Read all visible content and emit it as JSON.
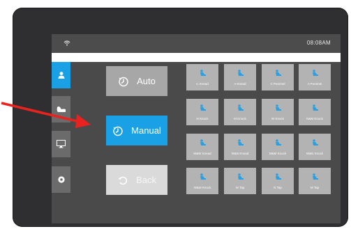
{
  "statusbar": {
    "time": "08:08AM",
    "wifi_icon": "wifi-icon"
  },
  "sidebar": {
    "items": [
      {
        "icon": "user-icon",
        "active": true
      },
      {
        "icon": "massage-chair-icon",
        "active": false
      },
      {
        "icon": "monitor-icon",
        "active": false
      },
      {
        "icon": "settings-icon",
        "active": false
      }
    ]
  },
  "modes": {
    "auto_label": "Auto",
    "manual_label": "Manual",
    "back_label": "Back"
  },
  "programs": [
    "C Knead",
    "A Knead",
    "C Pummel",
    "A Pummel",
    "N Knock",
    "M Knock",
    "W Knock",
    "N&M Knock",
    "M&W Knead",
    "W&N Knead",
    "M&M Knock",
    "W&N Knock",
    "W&M Knock",
    "W Tap",
    "N Tap",
    "M Tap"
  ],
  "colors": {
    "accent": "#1aa0e5",
    "tile": "#b3b3b3",
    "panel": "#4a4a4b",
    "bezel": "#2f2f31",
    "annotation_arrow": "#e8231f"
  }
}
